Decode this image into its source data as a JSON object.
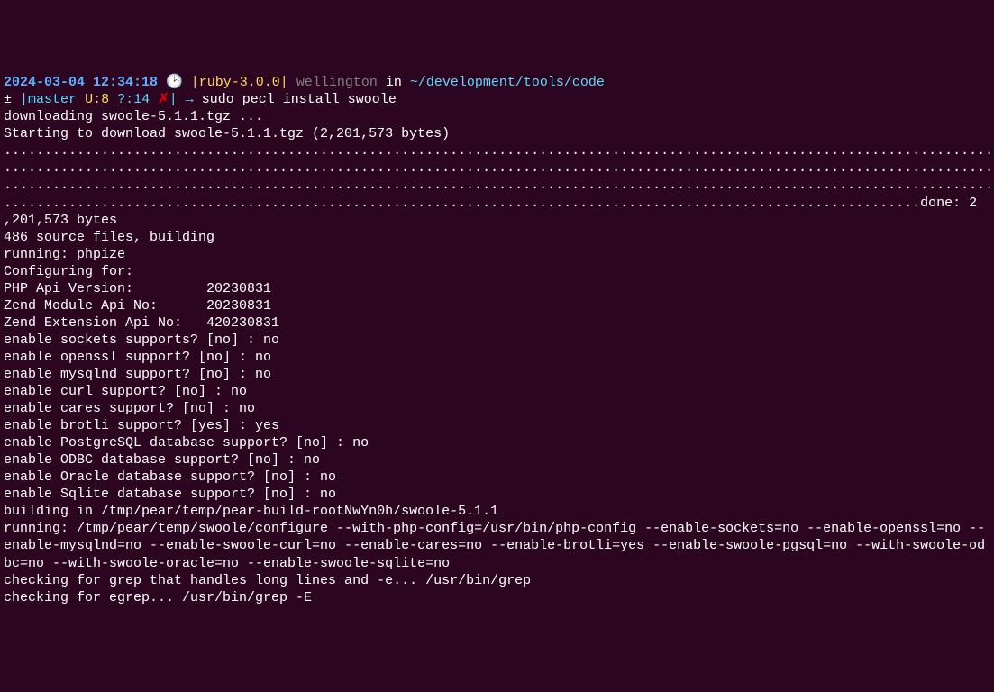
{
  "prompt": {
    "timestamp": "2024-03-04 12:34:18",
    "clock_icon": "🕑",
    "ruby_open": "|",
    "ruby": "ruby-3.0.0",
    "ruby_close": "|",
    "user": "wellington",
    "in": "in",
    "path": "~/development/tools/code",
    "git_symbol": "±",
    "git_pipe_open": "|",
    "git_branch": "master",
    "git_u": "U:8",
    "git_q": "?:14",
    "git_x": "✗",
    "git_pipe_close": "|",
    "arrow": "→",
    "command": "sudo pecl install swoole"
  },
  "output": {
    "l1": "downloading swoole-5.1.1.tgz ...",
    "l2": "Starting to download swoole-5.1.1.tgz (2,201,573 bytes)",
    "dots1": "..........................................................................................................................",
    "dots2": "..........................................................................................................................",
    "dots3": "..........................................................................................................................",
    "dots4": ".................................................................................................................done: 2",
    "l3": ",201,573 bytes",
    "l4": "486 source files, building",
    "l5": "running: phpize",
    "l6": "Configuring for:",
    "l7": "PHP Api Version:         20230831",
    "l8": "Zend Module Api No:      20230831",
    "l9": "Zend Extension Api No:   420230831",
    "l10": "enable sockets supports? [no] : no",
    "l11": "enable openssl support? [no] : no",
    "l12": "enable mysqlnd support? [no] : no",
    "l13": "enable curl support? [no] : no",
    "l14": "enable cares support? [no] : no",
    "l15": "enable brotli support? [yes] : yes",
    "l16": "enable PostgreSQL database support? [no] : no",
    "l17": "enable ODBC database support? [no] : no",
    "l18": "enable Oracle database support? [no] : no",
    "l19": "enable Sqlite database support? [no] : no",
    "l20": "building in /tmp/pear/temp/pear-build-rootNwYn0h/swoole-5.1.1",
    "l21": "running: /tmp/pear/temp/swoole/configure --with-php-config=/usr/bin/php-config --enable-sockets=no --enable-openssl=no --enable-mysqlnd=no --enable-swoole-curl=no --enable-cares=no --enable-brotli=yes --enable-swoole-pgsql=no --with-swoole-odbc=no --with-swoole-oracle=no --enable-swoole-sqlite=no",
    "l22": "checking for grep that handles long lines and -e... /usr/bin/grep",
    "l23": "checking for egrep... /usr/bin/grep -E"
  }
}
